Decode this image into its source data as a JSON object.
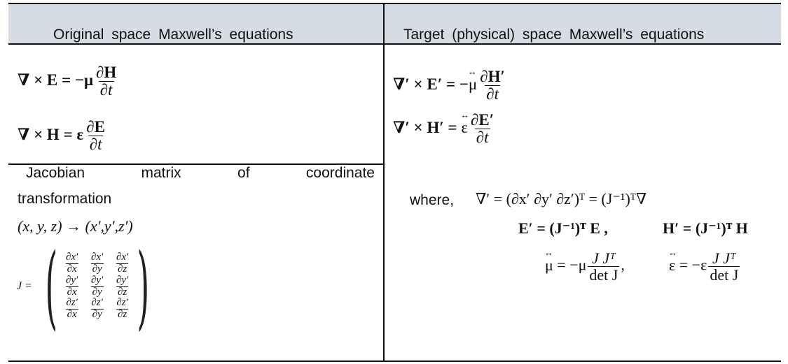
{
  "table": {
    "header": {
      "left": "Original space Maxwell’s equations",
      "right": "Target (physical) space Maxwell’s equations"
    },
    "left": {
      "equations": {
        "faraday": {
          "lhs": "∇ × E = −μ",
          "num": "∂H",
          "den": "∂t"
        },
        "ampere": {
          "lhs": "∇ × H = ε",
          "num": "∂E",
          "den": "∂t"
        }
      },
      "jacobian": {
        "caption_words": [
          "Jacobian",
          "matrix",
          "of",
          "coordinate"
        ],
        "caption_line2": "transformation",
        "mapping": "(x, y, z) → (x′,y′,z′)",
        "symbol": "J =",
        "matrix": [
          [
            {
              "num": "∂x′",
              "den": "∂x"
            },
            {
              "num": "∂x′",
              "den": "∂y"
            },
            {
              "num": "∂x′",
              "den": "∂z"
            }
          ],
          [
            {
              "num": "∂y′",
              "den": "∂x"
            },
            {
              "num": "∂y′",
              "den": "∂y"
            },
            {
              "num": "∂y′",
              "den": "∂z"
            }
          ],
          [
            {
              "num": "∂z′",
              "den": "∂x"
            },
            {
              "num": "∂z′",
              "den": "∂y"
            },
            {
              "num": "∂z′",
              "den": "∂z"
            }
          ]
        ]
      }
    },
    "right": {
      "equations": {
        "faraday": {
          "lhs": "∇′ × E′ = −",
          "tensor": "μ",
          "num": "∂H′",
          "den": "∂t"
        },
        "ampere": {
          "lhs": "∇′ × H′ = ",
          "tensor": "ε",
          "num": "∂E′",
          "den": "∂t"
        }
      },
      "where_label": "where,",
      "definitions": {
        "nabla_prime": "∇′ = (∂x′   ∂y′   ∂z′)ᵀ = (J⁻¹)ᵀ∇",
        "e_prime": "E′ = (J⁻¹)ᵀ E ,",
        "h_prime": "H′ = (J⁻¹)ᵀ H",
        "mu_tensor": {
          "tensor": "μ",
          "rhs": "= −μ",
          "num": "J Jᵀ",
          "den": "det J",
          "trail": ","
        },
        "eps_tensor": {
          "tensor": "ε",
          "rhs": "= −ε",
          "num": "J Jᵀ",
          "den": "det J"
        }
      }
    },
    "colors": {
      "header_bg": "#d6dce4",
      "border": "#111111"
    }
  }
}
